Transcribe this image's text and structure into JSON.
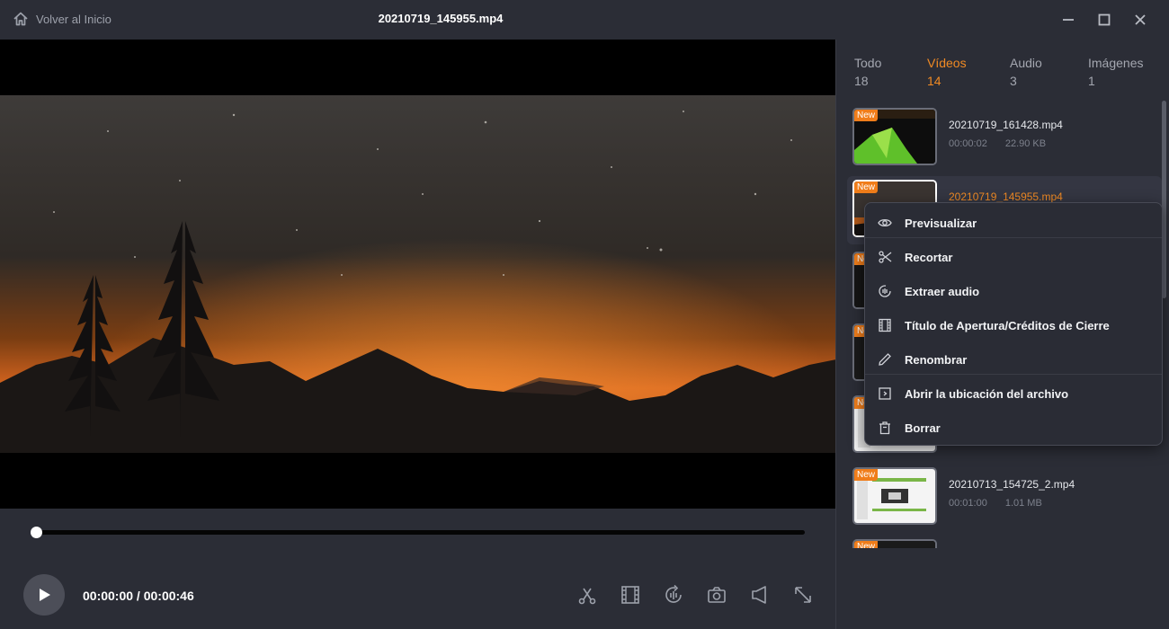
{
  "titlebar": {
    "back_label": "Volver al Inicio",
    "file_title": "20210719_145955.mp4",
    "back_icon": "home-icon",
    "window_icons": [
      "minimize-icon",
      "maximize-icon",
      "close-icon"
    ]
  },
  "player": {
    "time": "00:00:00 / 00:00:46",
    "progress": 0.0,
    "controls": [
      "cut-icon",
      "film-strip-icon",
      "rotate-icon",
      "snapshot-icon",
      "volume-icon",
      "fullscreen-icon"
    ]
  },
  "tabs": [
    {
      "label": "Todo",
      "count": "18",
      "active": false
    },
    {
      "label": "Vídeos",
      "count": "14",
      "active": true
    },
    {
      "label": "Audio",
      "count": "3",
      "active": false
    },
    {
      "label": "Imágenes",
      "count": "1",
      "active": false
    }
  ],
  "files": [
    {
      "badge": "New",
      "name": "20210719_161428.mp4",
      "duration": "00:00:02",
      "size": "22.90 KB"
    },
    {
      "badge": "New",
      "name": "20210719_145955.mp4",
      "duration": "",
      "size": ""
    },
    {
      "badge": "New",
      "name": "",
      "duration": "",
      "size": ""
    },
    {
      "badge": "New",
      "name": "",
      "duration": "",
      "size": ""
    },
    {
      "badge": "New",
      "name": "",
      "duration": "",
      "size": ""
    },
    {
      "badge": "New",
      "name": "20210713_154725_2.mp4",
      "duration": "00:01:00",
      "size": "1.01 MB"
    },
    {
      "badge": "New",
      "name": "",
      "duration": "",
      "size": ""
    }
  ],
  "context_menu": [
    {
      "label": "Previsualizar",
      "icon": "eye-icon"
    },
    {
      "label": "Recortar",
      "icon": "scissors-icon"
    },
    {
      "label": "Extraer audio",
      "icon": "audio-extract-icon"
    },
    {
      "label": "Título de Apertura/Créditos de Cierre",
      "icon": "film-title-icon"
    },
    {
      "label": "Renombrar",
      "icon": "pencil-icon"
    },
    {
      "label": "Abrir la ubicación del archivo",
      "icon": "folder-open-icon"
    },
    {
      "label": "Borrar",
      "icon": "trash-icon"
    }
  ],
  "bottom_tools": [
    "edit-icon",
    "sort-icon",
    "open-folder-icon",
    "delete-icon"
  ],
  "colors": {
    "accent": "#f08a24",
    "background": "#2b2d36",
    "badge": "#f07d1a"
  }
}
